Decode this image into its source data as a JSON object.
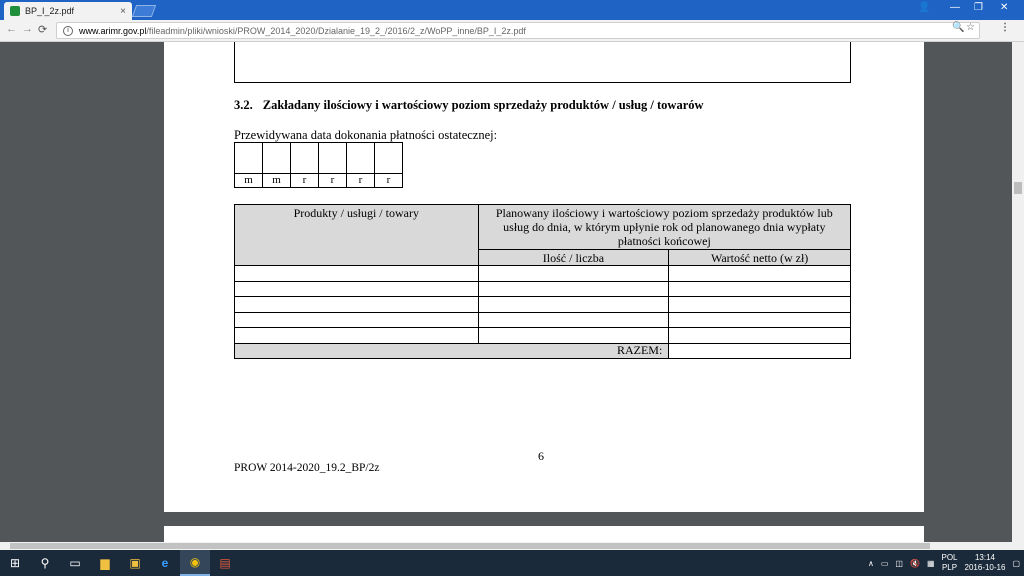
{
  "browser": {
    "tab_title": "BP_I_2z.pdf",
    "tab_close": "×",
    "url_host": "www.arimr.gov.pl",
    "url_path": "/fileadmin/pliki/wnioski/PROW_2014_2020/Dzialanie_19_2_/2016/2_z/WoPP_inne/BP_I_2z.pdf",
    "window_controls": [
      "—",
      "❐",
      "✕"
    ],
    "back": "←",
    "forward": "→",
    "reload": "⟳"
  },
  "document": {
    "section_number": "3.2.",
    "section_title": "Zakładany ilościowy i wartościowy poziom sprzedaży produktów / usług / towarów",
    "date_label": "Przewidywana data dokonania płatności ostatecznej:",
    "date_fields": [
      "m",
      "m",
      "r",
      "r",
      "r",
      "r"
    ],
    "table": {
      "col1_header": "Produkty / usługi / towary",
      "col2_header": "Planowany ilościowy i wartościowy poziom sprzedaży produktów lub usług do dnia, w którym upłynie rok od planowanego dnia wypłaty płatności końcowej",
      "sub_quantity": "Ilość / liczba",
      "sub_value": "Wartość netto (w zł)",
      "empty_rows": 5,
      "total_label": "RAZEM:"
    },
    "page_number": "6",
    "footer": "PROW 2014-2020_19.2_BP/2z"
  },
  "taskbar": {
    "language_top": "POL",
    "language_bottom": "PLP",
    "time": "13:14",
    "date": "2016-10-16"
  }
}
